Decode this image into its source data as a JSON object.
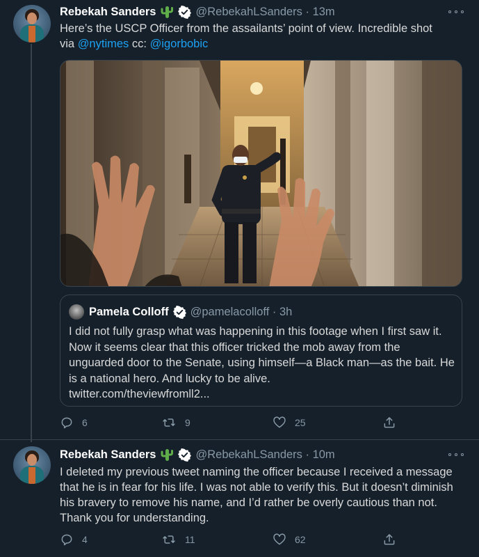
{
  "colors": {
    "background": "#15202b",
    "link": "#1da1f2",
    "secondary_text": "#8899a6",
    "border": "#38444d",
    "cactus_emoji": "#5fae4a",
    "verified_badge": "#ffffff"
  },
  "tweets": [
    {
      "author_name": "Rebekah Sanders",
      "name_emoji_icon": "cactus-emoji-icon",
      "handle_time": "@RebekahLSanders · 13m",
      "text_line1": "Here’s the USCP Officer from the assailants’ point of view. Incredible shot",
      "text_prefix": "via ",
      "mention1": "@nytimes",
      "text_mid": " cc: ",
      "mention2": "@igorbobic",
      "photo_icon": "hallway-officer-photo",
      "quote": {
        "author_name": "Pamela Colloff",
        "handle_time": "@pamelacolloff · 3h",
        "text": "I did not fully grasp what was happening in this footage when I first saw it. Now it seems clear that this officer tricked the mob away from the unguarded door to the Senate, using himself—a Black man—as the bait. He is a national hero. And lucky to be alive.",
        "link": "twitter.com/theviewfromll2..."
      },
      "replies": "6",
      "retweets": "9",
      "likes": "25"
    },
    {
      "author_name": "Rebekah Sanders",
      "name_emoji_icon": "cactus-emoji-icon",
      "handle_time": "@RebekahLSanders · 10m",
      "text": "I deleted my previous tweet naming the officer because I received a message that he is in fear for his life. I was not able to verify this. But it doesn’t diminish his bravery to remove his name, and I’d rather be overly cautious than not. Thank you for understanding.",
      "replies": "4",
      "retweets": "11",
      "likes": "62"
    }
  ]
}
